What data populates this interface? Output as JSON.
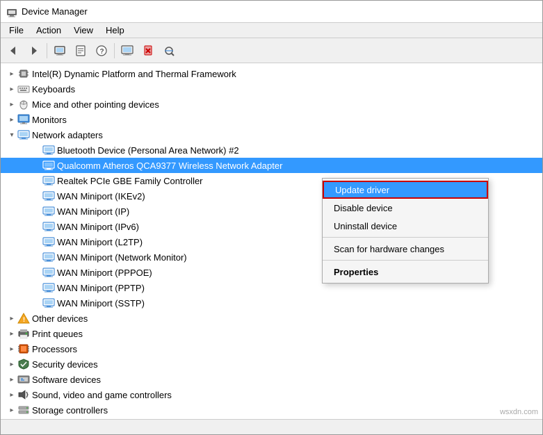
{
  "window": {
    "title": "Device Manager",
    "titleIcon": "⚙"
  },
  "menuBar": {
    "items": [
      "File",
      "Action",
      "View",
      "Help"
    ]
  },
  "toolbar": {
    "buttons": [
      {
        "name": "back",
        "label": "◀"
      },
      {
        "name": "forward",
        "label": "▶"
      },
      {
        "name": "show-all",
        "label": "🖥"
      },
      {
        "name": "properties",
        "label": "📄"
      },
      {
        "name": "help",
        "label": "❓"
      },
      {
        "name": "computer",
        "label": "🖥"
      },
      {
        "name": "scan",
        "label": "🔍"
      },
      {
        "name": "uninstall",
        "label": "✖"
      },
      {
        "name": "update",
        "label": "⬇"
      }
    ]
  },
  "tree": {
    "items": [
      {
        "id": "intel",
        "level": 1,
        "expanded": false,
        "label": "Intel(R) Dynamic Platform and Thermal Framework",
        "icon": "chip"
      },
      {
        "id": "keyboards",
        "level": 1,
        "expanded": false,
        "label": "Keyboards",
        "icon": "keyboard"
      },
      {
        "id": "mice",
        "level": 1,
        "expanded": false,
        "label": "Mice and other pointing devices",
        "icon": "mouse"
      },
      {
        "id": "monitors",
        "level": 1,
        "expanded": false,
        "label": "Monitors",
        "icon": "monitor"
      },
      {
        "id": "network",
        "level": 1,
        "expanded": true,
        "label": "Network adapters",
        "icon": "network"
      },
      {
        "id": "bluetooth",
        "level": 2,
        "label": "Bluetooth Device (Personal Area Network) #2",
        "icon": "network"
      },
      {
        "id": "qualcomm",
        "level": 2,
        "label": "Qualcomm Atheros QCA9377 Wireless Network Adapter",
        "icon": "network",
        "selected": true
      },
      {
        "id": "realtek",
        "level": 2,
        "label": "Realtek PCIe GBE Family Controller",
        "icon": "network"
      },
      {
        "id": "wan-ikev2",
        "level": 2,
        "label": "WAN Miniport (IKEv2)",
        "icon": "network"
      },
      {
        "id": "wan-ip",
        "level": 2,
        "label": "WAN Miniport (IP)",
        "icon": "network"
      },
      {
        "id": "wan-ipv6",
        "level": 2,
        "label": "WAN Miniport (IPv6)",
        "icon": "network"
      },
      {
        "id": "wan-l2tp",
        "level": 2,
        "label": "WAN Miniport (L2TP)",
        "icon": "network"
      },
      {
        "id": "wan-netmon",
        "level": 2,
        "label": "WAN Miniport (Network Monitor)",
        "icon": "network"
      },
      {
        "id": "wan-pppoe",
        "level": 2,
        "label": "WAN Miniport (PPPOE)",
        "icon": "network"
      },
      {
        "id": "wan-pptp",
        "level": 2,
        "label": "WAN Miniport (PPTP)",
        "icon": "network"
      },
      {
        "id": "wan-sstp",
        "level": 2,
        "label": "WAN Miniport (SSTP)",
        "icon": "network"
      },
      {
        "id": "other",
        "level": 1,
        "expanded": false,
        "label": "Other devices",
        "icon": "warning"
      },
      {
        "id": "print",
        "level": 1,
        "expanded": false,
        "label": "Print queues",
        "icon": "printer"
      },
      {
        "id": "processors",
        "level": 1,
        "expanded": false,
        "label": "Processors",
        "icon": "cpu"
      },
      {
        "id": "security",
        "level": 1,
        "expanded": false,
        "label": "Security devices",
        "icon": "security"
      },
      {
        "id": "software",
        "level": 1,
        "expanded": false,
        "label": "Software devices",
        "icon": "softdev"
      },
      {
        "id": "sound",
        "level": 1,
        "expanded": false,
        "label": "Sound, video and game controllers",
        "icon": "sound"
      },
      {
        "id": "storage",
        "level": 1,
        "expanded": false,
        "label": "Storage controllers",
        "icon": "storage"
      }
    ]
  },
  "contextMenu": {
    "items": [
      {
        "id": "update-driver",
        "label": "Update driver",
        "highlighted": true
      },
      {
        "id": "disable-device",
        "label": "Disable device"
      },
      {
        "id": "uninstall-device",
        "label": "Uninstall device"
      },
      {
        "id": "sep1",
        "type": "separator"
      },
      {
        "id": "scan-hardware",
        "label": "Scan for hardware changes"
      },
      {
        "id": "sep2",
        "type": "separator"
      },
      {
        "id": "properties",
        "label": "Properties",
        "bold": true
      }
    ]
  },
  "statusBar": {
    "text": ""
  },
  "watermark": "wsxdn.com"
}
